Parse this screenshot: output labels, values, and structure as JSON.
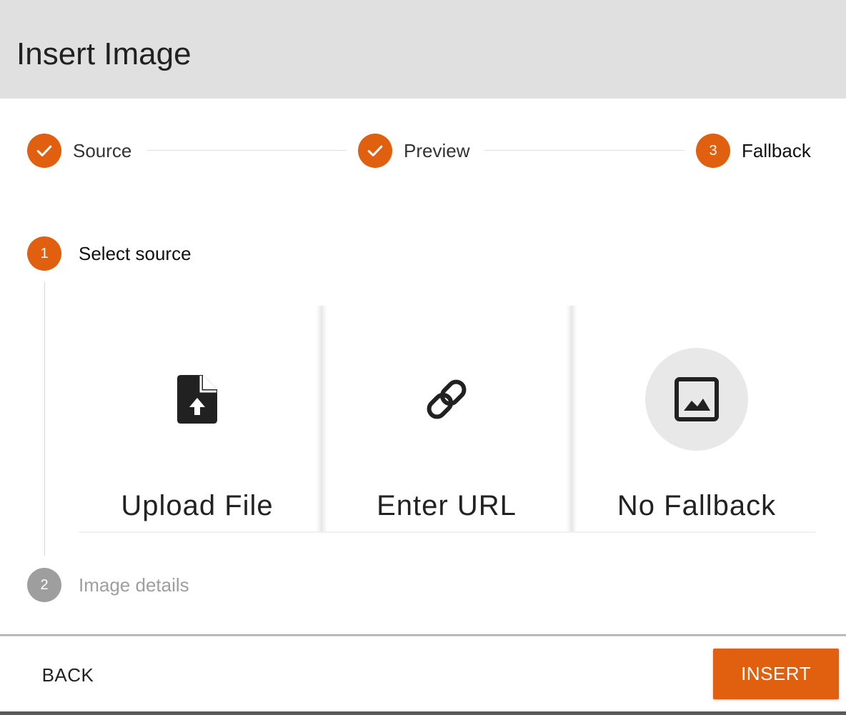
{
  "dialog": {
    "title": "Insert Image"
  },
  "stepper": {
    "steps": [
      {
        "label": "Source",
        "state": "done",
        "icon": "check-icon"
      },
      {
        "label": "Preview",
        "state": "done",
        "icon": "check-icon"
      },
      {
        "label": "Fallback",
        "number": "3",
        "state": "active"
      }
    ]
  },
  "substeps": [
    {
      "number": "1",
      "label": "Select source",
      "state": "active"
    },
    {
      "number": "2",
      "label": "Image details",
      "state": "inactive"
    }
  ],
  "options": [
    {
      "label": "Upload File",
      "icon": "upload-file-icon",
      "selected": false
    },
    {
      "label": "Enter URL",
      "icon": "link-icon",
      "selected": false
    },
    {
      "label": "No Fallback",
      "icon": "image-icon",
      "selected": true
    }
  ],
  "footer": {
    "back_label": "BACK",
    "insert_label": "INSERT"
  },
  "colors": {
    "accent": "#e06010",
    "header_bg": "#e0e0e0",
    "inactive": "#9e9e9e"
  }
}
